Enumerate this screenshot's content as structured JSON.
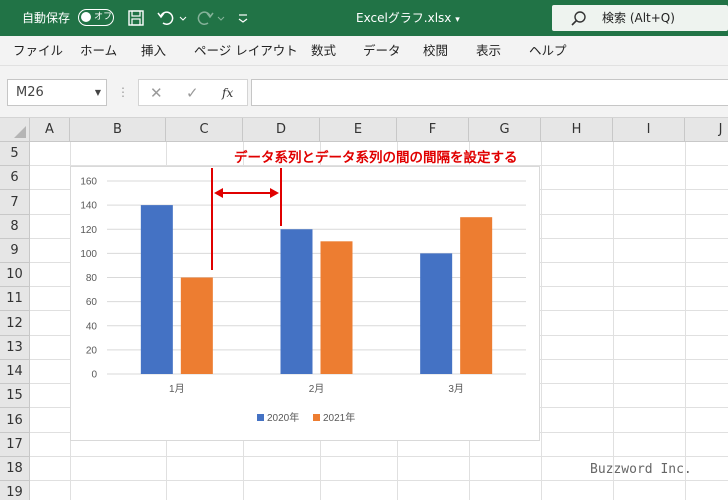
{
  "titlebar": {
    "autosave_label": "自動保存",
    "autosave_state": "オフ",
    "title": "Excelグラフ.xlsx",
    "title_caret": "▾",
    "search_text": "検索 (Alt+Q)",
    "bg_color": "#217346"
  },
  "menu": [
    "ファイル",
    "ホーム",
    "挿入",
    "ページ レイアウト",
    "数式",
    "データ",
    "校閲",
    "表示",
    "ヘルプ"
  ],
  "formula_bar": {
    "name_box": "M26",
    "cancel": "✕",
    "enter": "✓",
    "fx": "fx",
    "value": ""
  },
  "grid": {
    "columns": [
      "A",
      "B",
      "C",
      "D",
      "E",
      "F",
      "G",
      "H",
      "I",
      "J"
    ],
    "rows": [
      "5",
      "6",
      "7",
      "8",
      "9",
      "10",
      "11",
      "12",
      "13",
      "14",
      "15",
      "16",
      "17",
      "18",
      "19"
    ]
  },
  "chart_data": {
    "type": "bar",
    "categories": [
      "1月",
      "2月",
      "3月"
    ],
    "series": [
      {
        "name": "2020年",
        "values": [
          140,
          120,
          100
        ],
        "color": "#4472C4"
      },
      {
        "name": "2021年",
        "values": [
          80,
          110,
          130
        ],
        "color": "#ED7D31"
      }
    ],
    "yticks": [
      "0",
      "20",
      "40",
      "60",
      "80",
      "100",
      "120",
      "140",
      "160"
    ],
    "ylim": [
      0,
      160
    ],
    "grid": true,
    "legend": "bottom",
    "title": "",
    "xlabel": "",
    "ylabel": ""
  },
  "annotation": {
    "text": "データ系列とデータ系列の間の間隔を設定する",
    "color": "#E00000"
  },
  "watermark": "Buzzword Inc."
}
